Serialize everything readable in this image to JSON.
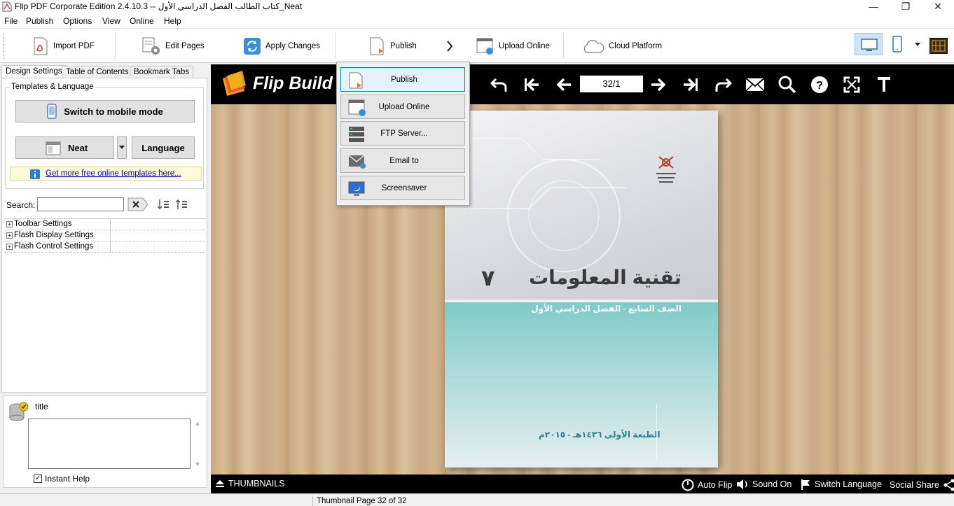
{
  "window": {
    "title": "Flip PDF Corporate Edition 2.4.10.3 -- كتاب الطالب الفصل الدراسي الأول_Neat",
    "minimize": "—",
    "maximize": "❐",
    "close": "✕"
  },
  "menu": [
    "File",
    "Publish",
    "Options",
    "View",
    "Online",
    "Help"
  ],
  "toolbar": {
    "import_pdf": "Import PDF",
    "edit_pages": "Edit Pages",
    "apply_changes": "Apply Changes",
    "publish": "Publish",
    "upload_online": "Upload Online",
    "cloud_platform": "Cloud Platform"
  },
  "left_panel": {
    "tabs": [
      "Design Settings",
      "Table of Contents",
      "Bookmark Tabs"
    ],
    "group_label": "Templates & Language",
    "switch_mobile": "Switch to mobile mode",
    "template_name": "Neat",
    "language": "Language",
    "templates_link": "Get more free online templates here...",
    "search_label": "Search:",
    "search_value": "",
    "tree": [
      "Toolbar Settings",
      "Flash Display Settings",
      "Flash Control Settings"
    ],
    "help_title": "title",
    "instant_help": "Instant Help",
    "instant_help_checked": true
  },
  "flip_viewer": {
    "logo": "Flip Build",
    "page_indicator": "32/1",
    "book": {
      "title": "تقنية المعلومات",
      "number": "٧",
      "subtitle": "الصف السابع - الفصل الدراسي الأول",
      "edition": "الطبعة الأولى ١٤٣٦هـ - ٢٠١٥م"
    },
    "bottom_bar": {
      "thumbnails": "THUMBNAILS",
      "auto_flip": "Auto Flip",
      "sound": "Sound On",
      "switch_language": "Switch Language",
      "social_share": "Social Share"
    }
  },
  "publish_dropdown": {
    "items": [
      "Publish",
      "Upload Online",
      "FTP Server...",
      "Email to",
      "Screensaver"
    ]
  },
  "status": {
    "text": "Thumbnail Page 32 of 32"
  }
}
